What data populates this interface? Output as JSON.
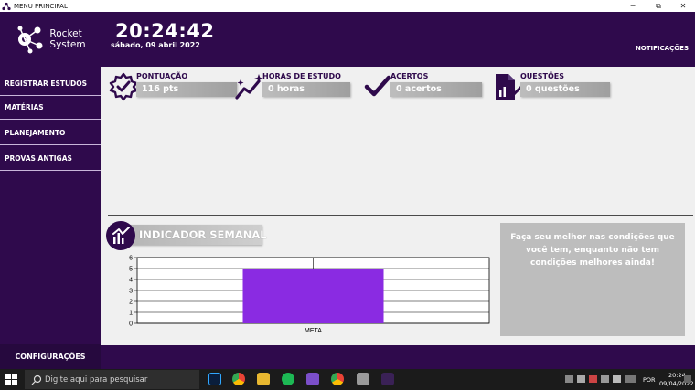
{
  "window": {
    "title": "MENU PRINCIPAL",
    "minimize_glyph": "─",
    "restore_glyph": "⧉",
    "close_glyph": "✕"
  },
  "header": {
    "logo_line1": "Rocket",
    "logo_line2": "System",
    "clock": "20:24:42",
    "date": "sábado, 09 abril 2022",
    "notifications": "NOTIFICAÇÕES"
  },
  "sidebar": {
    "items": [
      {
        "label": "REGISTRAR ESTUDOS"
      },
      {
        "label": "MATÉRIAS"
      },
      {
        "label": "PLANEJAMENTO"
      },
      {
        "label": "PROVAS ANTIGAS"
      }
    ],
    "settings": "CONFIGURAÇÕES"
  },
  "stats": [
    {
      "label": "PONTUAÇÃO",
      "value": "116 pts",
      "icon": "badge-check-icon"
    },
    {
      "label": "HORAS DE ESTUDO",
      "value": "0 horas",
      "icon": "trend-stars-icon"
    },
    {
      "label": "ACERTOS",
      "value": "0 acertos",
      "icon": "checkmark-icon"
    },
    {
      "label": "QUESTÕES",
      "value": "0 questões",
      "icon": "document-chart-icon"
    }
  ],
  "indicator": {
    "title": "INDICADOR SEMANAL"
  },
  "quote": "Faça seu melhor nas condições que você tem, enquanto não tem condições melhores ainda!",
  "colors": {
    "primary": "#2f0a4c",
    "bar": "#8a2be2",
    "panel": "#f0f0f0"
  },
  "chart_data": {
    "type": "bar",
    "categories": [
      "META"
    ],
    "values": [
      5
    ],
    "ylim": [
      0,
      6
    ],
    "yticks": [
      "0",
      "1",
      "2",
      "3",
      "4",
      "5",
      "6"
    ],
    "grid": true,
    "bar_color": "#8a2be2"
  },
  "taskbar": {
    "search_placeholder": "Digite aqui para pesquisar",
    "language": "POR",
    "time": "20:24",
    "date": "09/04/2022"
  }
}
